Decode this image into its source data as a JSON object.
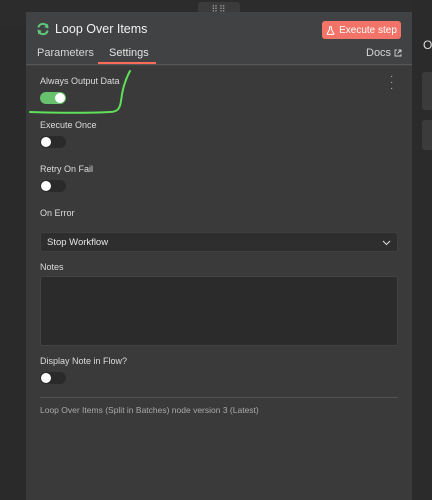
{
  "node": {
    "title": "Loop Over Items",
    "execute_label": "Execute step",
    "icon": "refresh-icon",
    "accent": "#f27468"
  },
  "tabs": {
    "parameters": "Parameters",
    "settings": "Settings",
    "docs": "Docs",
    "active": "Settings"
  },
  "settings": {
    "always_output_data": {
      "label": "Always Output Data",
      "value": true
    },
    "execute_once": {
      "label": "Execute Once",
      "value": false
    },
    "retry_on_fail": {
      "label": "Retry On Fail",
      "value": false
    },
    "on_error": {
      "label": "On Error",
      "value": "Stop Workflow"
    },
    "notes": {
      "label": "Notes",
      "value": ""
    },
    "display_note": {
      "label": "Display Note in Flow?",
      "value": false
    }
  },
  "version_note": "Loop Over Items (Split in Batches) node version 3 (Latest)",
  "background": {
    "right_letter": "O"
  },
  "colors": {
    "toggle_on": "#68c16c",
    "annotation": "#5fe15a",
    "tab_underline": "#ff6d5a"
  }
}
